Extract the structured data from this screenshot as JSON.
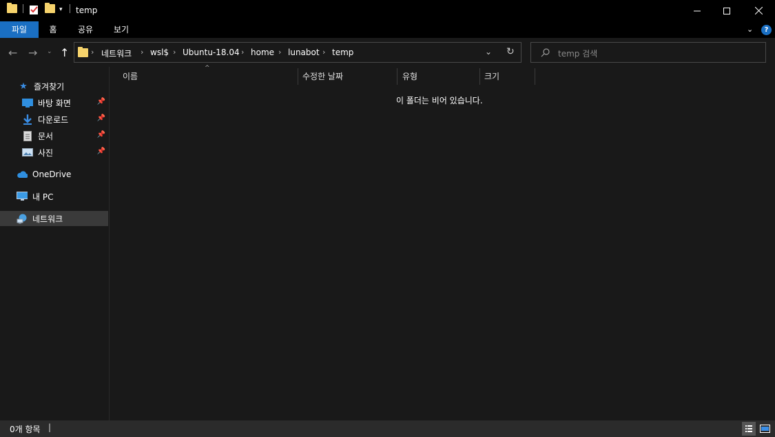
{
  "window": {
    "title": "temp"
  },
  "ribbon": {
    "tabs": [
      {
        "label": "파일",
        "active": true
      },
      {
        "label": "홈"
      },
      {
        "label": "공유"
      },
      {
        "label": "보기"
      }
    ]
  },
  "address": {
    "breadcrumb": [
      "네트워크",
      "wsl$",
      "Ubuntu-18.04",
      "home",
      "lunabot",
      "temp"
    ]
  },
  "search": {
    "placeholder": "temp 검색"
  },
  "sidebar": {
    "items": [
      {
        "label": "즐겨찾기",
        "icon": "star-icon"
      },
      {
        "label": "바탕 화면",
        "icon": "desktop-icon",
        "pinned": true
      },
      {
        "label": "다운로드",
        "icon": "download-icon",
        "pinned": true
      },
      {
        "label": "문서",
        "icon": "document-icon",
        "pinned": true
      },
      {
        "label": "사진",
        "icon": "pictures-icon",
        "pinned": true
      },
      {
        "label": "OneDrive",
        "icon": "cloud-icon"
      },
      {
        "label": "내 PC",
        "icon": "computer-icon"
      },
      {
        "label": "네트워크",
        "icon": "network-icon",
        "selected": true
      }
    ]
  },
  "columns": [
    "이름",
    "수정한 날짜",
    "유형",
    "크기"
  ],
  "content": {
    "empty_message": "이 폴더는 비어 있습니다."
  },
  "status": {
    "item_count": "0개 항목"
  },
  "colors": {
    "accent": "#1a6fc3",
    "background": "#191919",
    "titlebar": "#000000",
    "folder": "#f6d36c"
  }
}
